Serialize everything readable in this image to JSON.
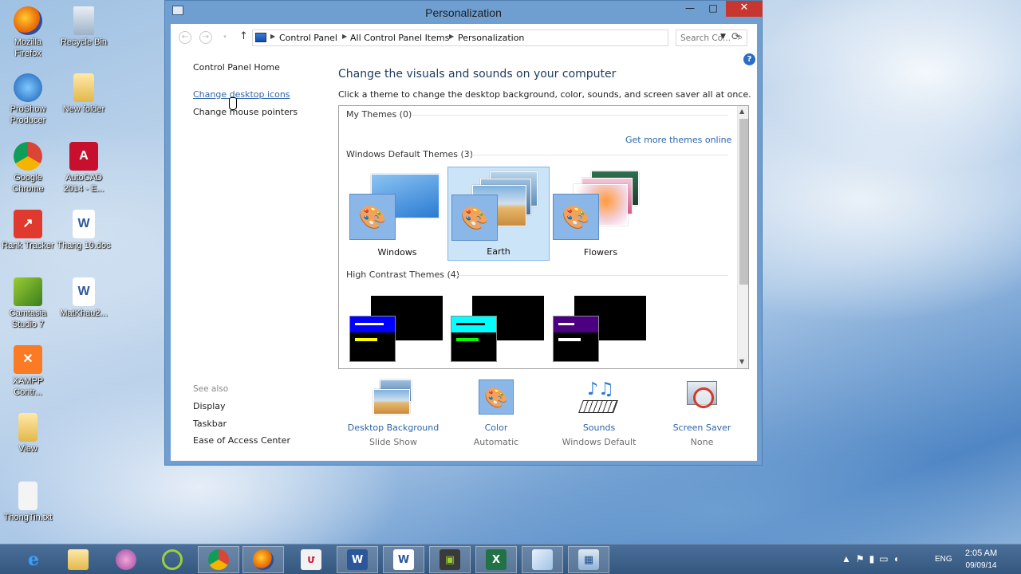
{
  "desktop": {
    "icons": [
      {
        "label": "Mozilla Firefox"
      },
      {
        "label": "Recycle Bin"
      },
      {
        "label": "ProShow Producer"
      },
      {
        "label": "New folder"
      },
      {
        "label": "Google Chrome"
      },
      {
        "label": "AutoCAD 2014 - E..."
      },
      {
        "label": "Rank Tracker"
      },
      {
        "label": "Thang 10.doc"
      },
      {
        "label": "Camtasia Studio 7"
      },
      {
        "label": "MatKhau2..."
      },
      {
        "label": "XAMPP Contr..."
      },
      {
        "label": "View"
      },
      {
        "label": "ThongTin.txt"
      }
    ]
  },
  "window": {
    "title": "Personalization",
    "controls": {
      "minimize": "—",
      "maximize": "□",
      "close": "✕"
    }
  },
  "address": {
    "crumbs": [
      "Control Panel",
      "All Control Panel Items",
      "Personalization"
    ],
    "search_placeholder": "Search Co..."
  },
  "left_pane": {
    "home": "Control Panel Home",
    "links": [
      "Change desktop icons",
      "Change mouse pointers"
    ],
    "see_also_title": "See also",
    "see_also": [
      "Display",
      "Taskbar",
      "Ease of Access Center"
    ]
  },
  "main": {
    "heading": "Change the visuals and sounds on your computer",
    "description": "Click a theme to change the desktop background, color, sounds, and screen saver all at once.",
    "groups": {
      "my_themes": "My Themes (0)",
      "get_more": "Get more themes online",
      "default_themes": "Windows Default Themes (3)",
      "high_contrast": "High Contrast Themes (4)"
    },
    "themes": [
      {
        "name": "Windows",
        "selected": false
      },
      {
        "name": "Earth",
        "selected": true
      },
      {
        "name": "Flowers",
        "selected": false
      }
    ],
    "high_contrast_colors": [
      {
        "bar1": "#0000ff",
        "bar2": "#ffff00"
      },
      {
        "bar1": "#00ffff",
        "bar2": "#00ff00"
      },
      {
        "bar1": "#4b0082",
        "bar2": "#ffffff"
      }
    ]
  },
  "settings": [
    {
      "label": "Desktop Background",
      "value": "Slide Show"
    },
    {
      "label": "Color",
      "value": "Automatic"
    },
    {
      "label": "Sounds",
      "value": "Windows Default"
    },
    {
      "label": "Screen Saver",
      "value": "None"
    }
  ],
  "taskbar": {
    "lang": "ENG",
    "time": "2:05 AM",
    "date": "09/09/14"
  }
}
